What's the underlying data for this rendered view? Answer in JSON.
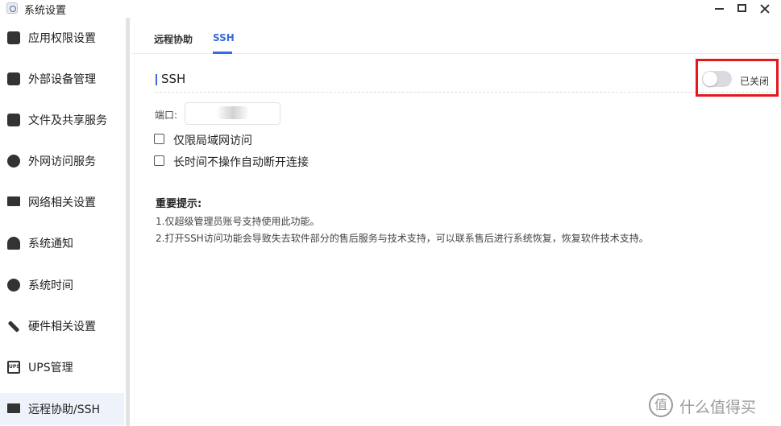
{
  "window": {
    "title": "系统设置"
  },
  "sidebar": {
    "items": [
      {
        "label": "应用权限设置",
        "icon": "sliders-icon"
      },
      {
        "label": "外部设备管理",
        "icon": "device-icon"
      },
      {
        "label": "文件及共享服务",
        "icon": "file-icon"
      },
      {
        "label": "外网访问服务",
        "icon": "link-icon"
      },
      {
        "label": "网络相关设置",
        "icon": "network-icon"
      },
      {
        "label": "系统通知",
        "icon": "bell-icon"
      },
      {
        "label": "系统时间",
        "icon": "globe-clock-icon"
      },
      {
        "label": "硬件相关设置",
        "icon": "tools-icon"
      },
      {
        "label": "UPS管理",
        "icon": "ups-icon"
      },
      {
        "label": "远程协助/SSH",
        "icon": "monitor-icon",
        "active": true
      }
    ]
  },
  "tabs": [
    {
      "label": "远程协助"
    },
    {
      "label": "SSH",
      "active": true
    }
  ],
  "ssh": {
    "section_title": "SSH",
    "toggle_state": "已关闭",
    "toggle_on": false,
    "port_label": "端口:",
    "port_value": "",
    "options": [
      {
        "label": "仅限局域网访问",
        "checked": false
      },
      {
        "label": "长时间不操作自动断开连接",
        "checked": false
      }
    ]
  },
  "notice": {
    "title": "重要提示:",
    "lines": [
      "1.仅超级管理员账号支持使用此功能。",
      "2.打开SSH访问功能会导致失去软件部分的售后服务与技术支持，可以联系售后进行系统恢复，恢复软件技术支持。"
    ]
  },
  "watermark": {
    "glyph": "值",
    "text": "什么值得买"
  },
  "colors": {
    "accent": "#3a6bdc",
    "highlight": "#e5161c",
    "toggle_off": "#d9dbe0"
  },
  "ui": {
    "ups_icon_text": "UPS"
  }
}
